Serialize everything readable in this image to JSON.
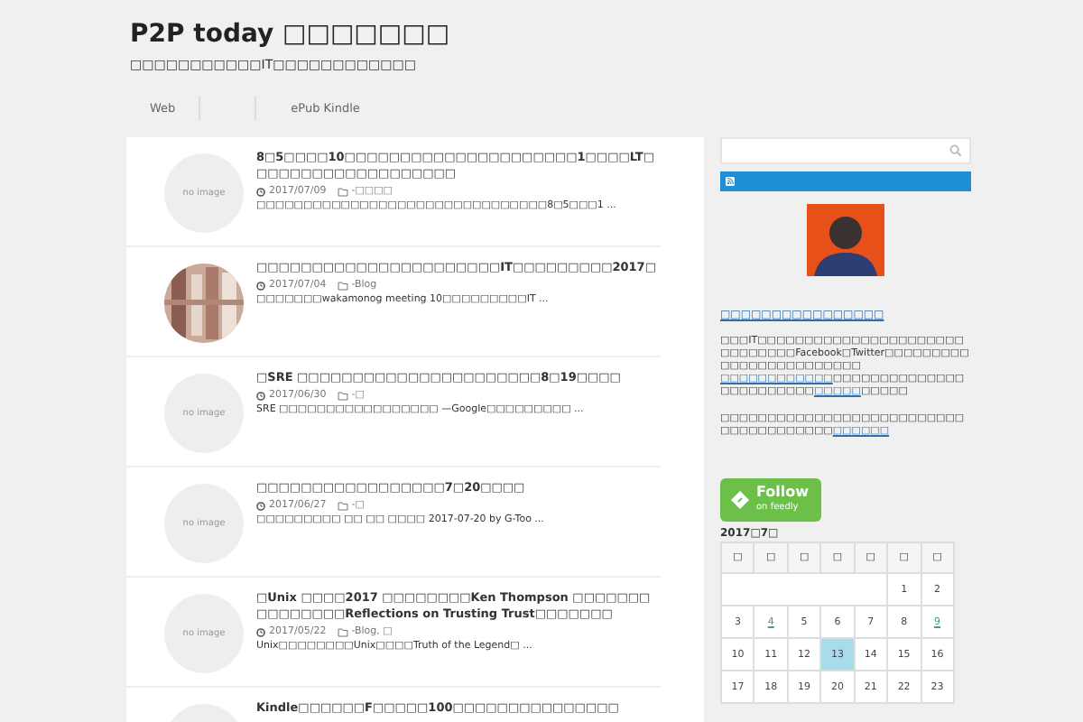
{
  "header": {
    "title": "P2P today □□□□□□□",
    "tagline": "□□□□□□□□□□□IT□□□□□□□□□□□□"
  },
  "nav": [
    {
      "label": "Web"
    },
    {
      "label": "ePub Kindle"
    }
  ],
  "posts": [
    {
      "title": "8□5□□□□10□□□□□□□□□□□□□□□□□□□□□1□□□□LT□□□□□□□□□□□□□□□□□□□",
      "date": "2017/07/09",
      "category": "-□□□□",
      "excerpt": "□□□□□□□□□□□□□□□□□□□□□□□□□□□□□□□8□5□□□1 ...",
      "thumb": {
        "kind": "noimage",
        "label": "no image"
      }
    },
    {
      "title": "□□□□□□□□□□□□□□□□□□□□□□IT□□□□□□□□□2017□",
      "date": "2017/07/04",
      "category": "-Blog",
      "excerpt": "□□□□□□□wakamonog meeting 10□□□□□□□□□IT ..."
    },
    {
      "title": "□SRE □□□□□□□□□□□□□□□□□□□□□□8□19□□□□",
      "date": "2017/06/30",
      "category": "-□",
      "excerpt": "SRE □□□□□□□□□□□□□□□□□ —Google□□□□□□□□□ ...",
      "thumb": {
        "kind": "noimage",
        "label": "no image"
      }
    },
    {
      "title": "□□□□□□□□□□□□□□□□□7□20□□□□",
      "date": "2017/06/27",
      "category": "-□",
      "excerpt": "□□□□□□□□□ □□ □□ □□□□ 2017-07-20 by G-Too ...",
      "thumb": {
        "kind": "noimage",
        "label": "no image"
      }
    },
    {
      "title": "□Unix □□□□2017 □□□□□□□□Ken Thompson □□□□□□□□□□□□□□□Reflections on Trusting Trust□□□□□□□",
      "date": "2017/05/22",
      "category": "-Blog, □",
      "excerpt": "Unix□□□□□□□□Unix□□□□Truth of the Legend□ ...",
      "thumb": {
        "kind": "noimage",
        "label": "no image"
      }
    },
    {
      "title": "Kindle□□□□□□F□□□□□100□□□□□□□□□□□□□□□",
      "thumb": {
        "kind": "noimage"
      }
    }
  ],
  "sidebar": {
    "profile_link": "□□□□□□□□□□□□□□□□",
    "paragraphs": [
      [
        {
          "kind": "text",
          "text": "□□□IT□□□□□□□□□□□□□□□□□□□□□□□□□□□□□□Facebook□Twitter□□□□□□□□□□□□□□□□□□□□□□□□"
        },
        {
          "kind": "link",
          "text": "□□□□□□□□□□□□"
        },
        {
          "kind": "text",
          "text": "□□□□□□□□□□□□□□□□□□□□□□□□"
        },
        {
          "kind": "link",
          "text": "□□□□□"
        },
        {
          "kind": "text",
          "text": "□□□□□"
        }
      ],
      [
        {
          "kind": "text",
          "text": "□□□□□□□□□□□□□□□□□□□□□□□□□□□□□□□□□□□□□□"
        },
        {
          "kind": "link",
          "text": "□□□□□□"
        }
      ]
    ],
    "feedly": {
      "title": "Follow",
      "subtitle": "on feedly"
    },
    "calendar": {
      "caption": "2017□7□",
      "weekdays": [
        "□",
        "□",
        "□",
        "□",
        "□",
        "□",
        "□"
      ],
      "weeks": [
        [
          {
            "day": "1",
            "linked": false,
            "today": false
          },
          {
            "day": "2",
            "linked": false,
            "today": false
          }
        ],
        [
          {
            "day": "3",
            "linked": false,
            "today": false
          },
          {
            "day": "4",
            "linked": true,
            "today": false
          },
          {
            "day": "5",
            "linked": false,
            "today": false
          },
          {
            "day": "6",
            "linked": false,
            "today": false
          },
          {
            "day": "7",
            "linked": false,
            "today": false
          },
          {
            "day": "8",
            "linked": false,
            "today": false
          },
          {
            "day": "9",
            "linked": true,
            "today": false
          }
        ],
        [
          {
            "day": "10",
            "linked": false,
            "today": false
          },
          {
            "day": "11",
            "linked": false,
            "today": false
          },
          {
            "day": "12",
            "linked": false,
            "today": false
          },
          {
            "day": "13",
            "linked": false,
            "today": true
          },
          {
            "day": "14",
            "linked": false,
            "today": false
          },
          {
            "day": "15",
            "linked": false,
            "today": false
          },
          {
            "day": "16",
            "linked": false,
            "today": false
          }
        ],
        [
          {
            "day": "17",
            "linked": false,
            "today": false
          },
          {
            "day": "18",
            "linked": false,
            "today": false
          },
          {
            "day": "19",
            "linked": false,
            "today": false
          },
          {
            "day": "20",
            "linked": false,
            "today": false
          },
          {
            "day": "21",
            "linked": false,
            "today": false
          },
          {
            "day": "22",
            "linked": false,
            "today": false
          },
          {
            "day": "23",
            "linked": false,
            "today": false
          }
        ]
      ]
    }
  }
}
